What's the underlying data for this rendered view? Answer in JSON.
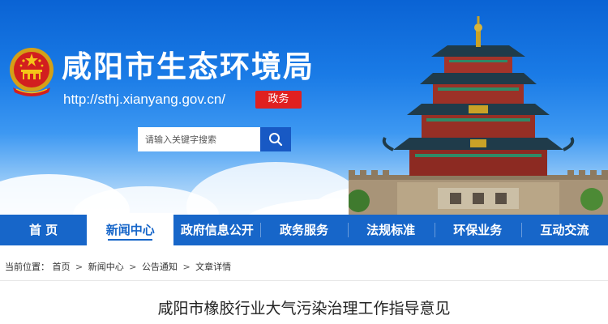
{
  "header": {
    "title": "咸阳市生态环境局",
    "url": "http://sthj.xianyang.gov.cn/",
    "badge": "政务"
  },
  "search": {
    "placeholder": "请输入关键字搜索"
  },
  "nav": {
    "items": [
      {
        "label": "首 页"
      },
      {
        "label": "新闻中心"
      },
      {
        "label": "政府信息公开"
      },
      {
        "label": "政务服务"
      },
      {
        "label": "法规标准"
      },
      {
        "label": "环保业务"
      },
      {
        "label": "互动交流"
      }
    ],
    "active_index": 1
  },
  "breadcrumb": {
    "prefix": "当前位置：",
    "items": [
      "首页",
      "新闻中心",
      "公告通知",
      "文章详情"
    ],
    "separator": ">"
  },
  "article": {
    "title": "咸阳市橡胶行业大气污染治理工作指导意见"
  },
  "colors": {
    "nav_bg": "#1766c9",
    "badge_red": "#e02020",
    "search_button": "#1859c4"
  },
  "icons": [
    "national-emblem-icon",
    "search-icon"
  ]
}
